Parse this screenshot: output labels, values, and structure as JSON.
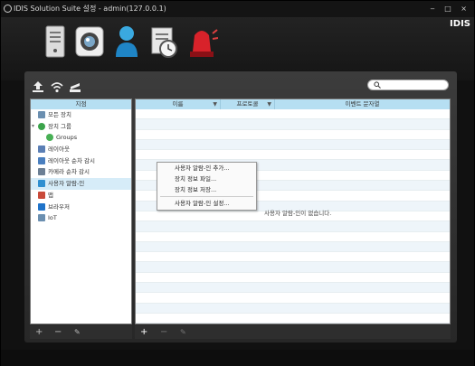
{
  "window": {
    "title": "IDIS Solution Suite 설정 - admin(127.0.0.1)",
    "brand": "IDIS",
    "controls": [
      "‒",
      "□",
      "×"
    ]
  },
  "toolbar": {
    "active_label": "장치",
    "items": [
      "server-icon",
      "device-camera-icon",
      "user-icon",
      "schedule-icon",
      "alarm-icon"
    ]
  },
  "panel": {
    "search_placeholder": ""
  },
  "tree": {
    "header": "지점",
    "items": [
      {
        "label": "모든 장치",
        "icon": "all-devices-icon"
      },
      {
        "label": "장치 그룹",
        "icon": "device-group-icon"
      },
      {
        "label": "Groups",
        "icon": "groups-icon"
      },
      {
        "label": "레이아웃",
        "icon": "layout-icon"
      },
      {
        "label": "레이아웃 순차 감시",
        "icon": "layout-sequence-icon"
      },
      {
        "label": "카메라 순차 감시",
        "icon": "camera-sequence-icon"
      },
      {
        "label": "사용자 알람-인",
        "icon": "user-alarm-in-icon"
      },
      {
        "label": "맵",
        "icon": "map-icon"
      },
      {
        "label": "브라우저",
        "icon": "browser-icon"
      },
      {
        "label": "IoT",
        "icon": "iot-icon"
      }
    ]
  },
  "table": {
    "columns": [
      "이름",
      "프로토콜",
      "이벤트 문자열"
    ],
    "empty_message": "사용자 알람-인이 없습니다."
  },
  "context_menu": {
    "items": [
      "사용자 알람-인 추가...",
      "장치 정보 파일...",
      "장치 정보 저장...",
      "사용자 알람-인 설정..."
    ]
  },
  "left_bottom": {
    "add": "+",
    "remove": "−",
    "edit": "✎"
  },
  "right_bottom": {
    "add": "+",
    "remove": "−",
    "edit": "✎"
  }
}
